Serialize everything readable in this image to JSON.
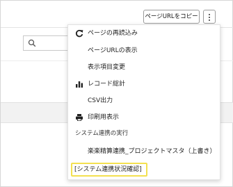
{
  "header": {
    "copy_url_label": "ページURLをコピー"
  },
  "menu": {
    "items": [
      {
        "label": "ページの再読込み",
        "icon": "refresh-icon"
      },
      {
        "label": "ページURLの表示",
        "icon": ""
      },
      {
        "label": "表示項目変更",
        "icon": ""
      },
      {
        "label": "レコード総計",
        "icon": "bar-chart-icon"
      },
      {
        "label": "CSV出力",
        "icon": ""
      },
      {
        "label": "印刷用表示",
        "icon": "print-icon"
      }
    ],
    "section_title": "システム連携の実行",
    "sub_item": "楽楽精算連携_プロジェクトマスタ（上書き）",
    "highlighted_item": "[システム連携状況確認]"
  },
  "colors": {
    "highlight_border": "#f3e04f",
    "menu_border": "#e2e2e2"
  }
}
